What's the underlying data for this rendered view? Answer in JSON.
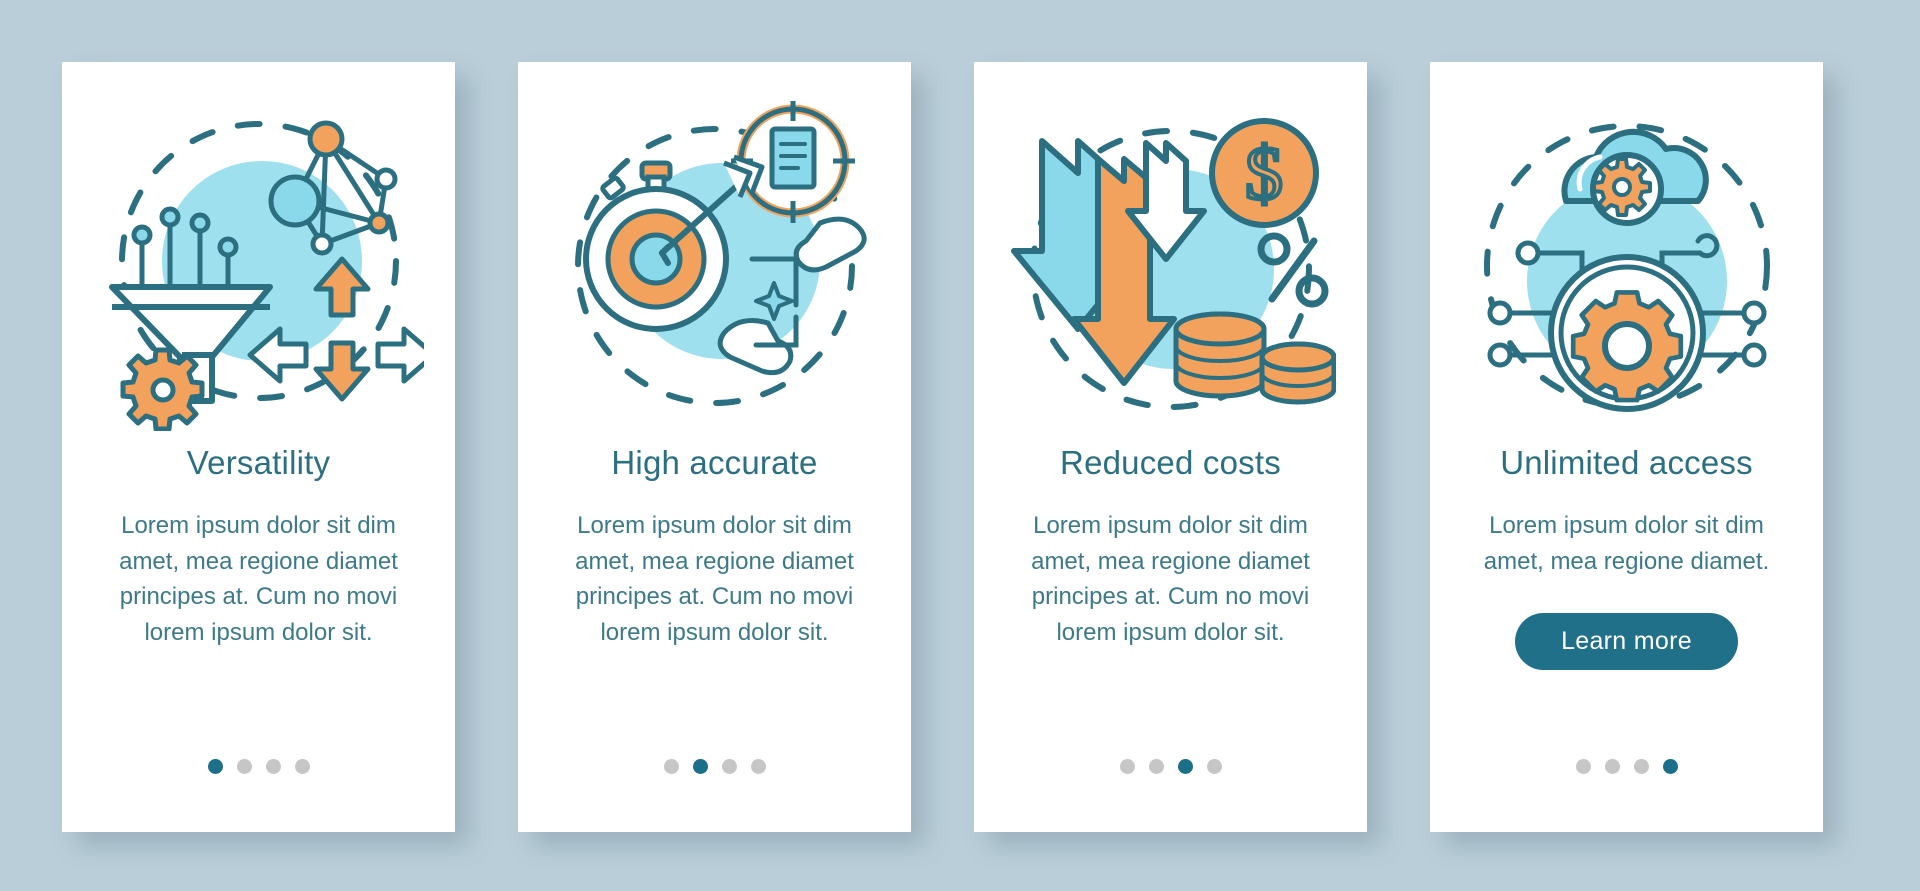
{
  "page": {
    "background_color": "#b9ced9",
    "card_background": "#ffffff",
    "accent_teal": "#2b6f81",
    "accent_orange": "#f2a25c",
    "accent_cyan": "#9fe0ef",
    "dot_inactive": "#c6c6c6",
    "dot_active": "#1d6e89",
    "button_color": "#20708a"
  },
  "cards": [
    {
      "icon": "funnel-network-arrows-gear-icon",
      "title": "Versatility",
      "body": "Lorem ipsum dolor sit dim amet, mea regione diamet principes at. Cum no movi lorem ipsum dolor sit.",
      "has_button": false,
      "button_label": "",
      "dots_total": 4,
      "dot_active_index": 0
    },
    {
      "icon": "stopwatch-target-arrow-document-icon",
      "title": "High accurate",
      "body": "Lorem ipsum dolor sit dim amet, mea regione diamet principes at. Cum no movi lorem ipsum dolor sit.",
      "has_button": false,
      "button_label": "",
      "dots_total": 4,
      "dot_active_index": 1
    },
    {
      "icon": "down-arrows-dollar-coins-percent-icon",
      "title": "Reduced costs",
      "body": "Lorem ipsum dolor sit dim amet, mea regione diamet principes at. Cum no movi lorem ipsum dolor sit.",
      "has_button": false,
      "button_label": "",
      "dots_total": 4,
      "dot_active_index": 2
    },
    {
      "icon": "cloud-gear-circuit-icon",
      "title": "Unlimited access",
      "body": "Lorem ipsum dolor sit dim amet, mea regione diamet.",
      "has_button": true,
      "button_label": "Learn more",
      "dots_total": 4,
      "dot_active_index": 3
    }
  ]
}
